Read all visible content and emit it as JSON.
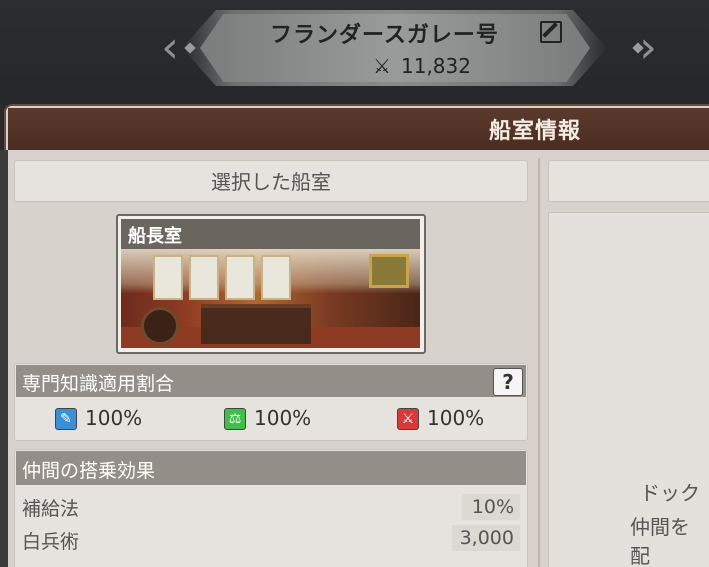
{
  "ship": {
    "name": "フランダースガレー号",
    "power": "11,832"
  },
  "panel": {
    "title": "船室情報"
  },
  "selected_cabin": {
    "header": "選択した船室",
    "cabin_name": "船長室"
  },
  "expertise": {
    "title": "専門知識適用割合",
    "help_label": "?",
    "stats": [
      {
        "icon": "adventure-icon",
        "color": "#3a8fd6",
        "value": "100%"
      },
      {
        "icon": "trade-icon",
        "color": "#3fbf4a",
        "value": "100%"
      },
      {
        "icon": "battle-icon",
        "color": "#d83a3a",
        "value": "100%"
      }
    ]
  },
  "crew_effect": {
    "title": "仲間の搭乗効果",
    "rows": [
      {
        "label": "補給法",
        "value": "10%"
      },
      {
        "label": "白兵術",
        "value": "3,000"
      }
    ]
  },
  "right_panel": {
    "message_line1": "ドック",
    "message_line2": "仲間を配"
  }
}
